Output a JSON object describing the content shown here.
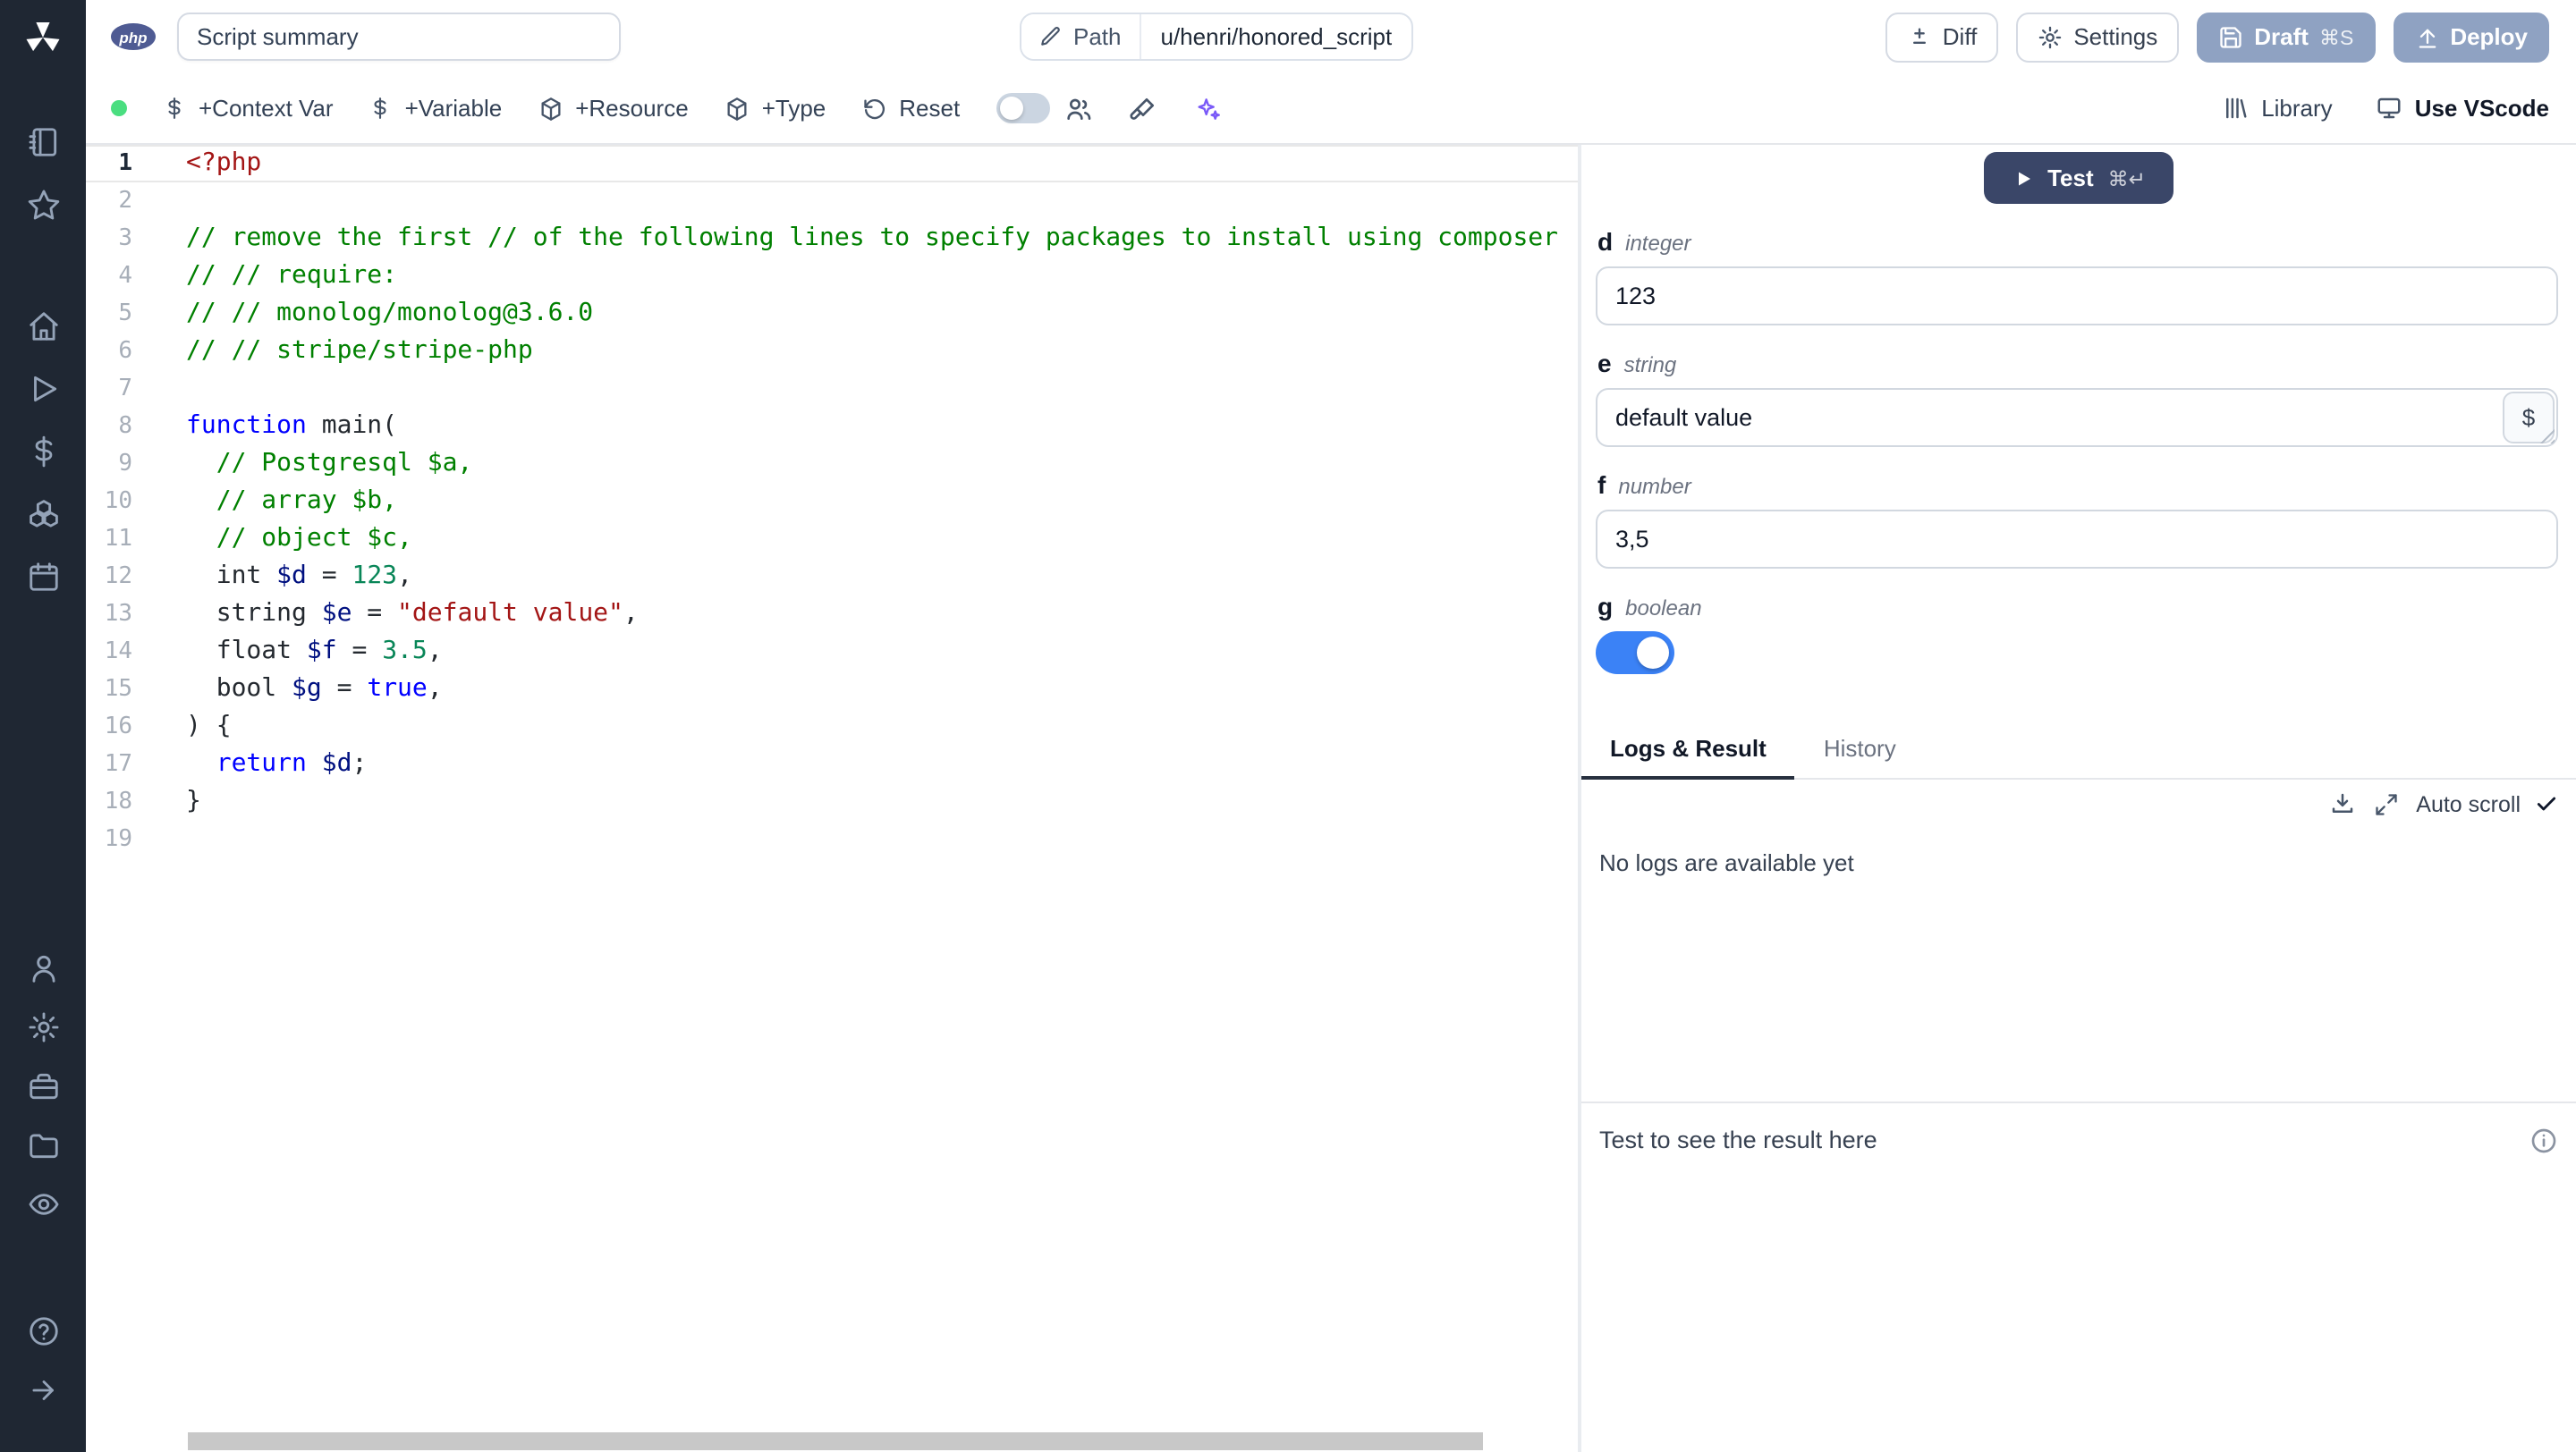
{
  "colors": {
    "sidebar_bg": "#1f2733",
    "accent_dark": "#3a4668",
    "accent_muted": "#8fa2c2",
    "toggle_on": "#3b82f6",
    "status_green": "#4ade80",
    "php_badge": "#4f5b93",
    "token_tag": "#a31515",
    "token_comment": "#008000",
    "token_keyword": "#0000ff",
    "token_variable": "#001080",
    "token_number": "#098658",
    "token_string": "#a31515",
    "token_plain": "#24292f"
  },
  "sidebar": {
    "groups": {
      "top": [
        "notebook",
        "star"
      ],
      "main": [
        "home",
        "play",
        "dollar",
        "boxes",
        "calendar"
      ],
      "account": [
        "user",
        "settings",
        "toolbox",
        "folder",
        "eye"
      ],
      "footer": [
        "help",
        "arrow-right"
      ]
    }
  },
  "topbar": {
    "language_badge": "php",
    "summary_value": "Script summary",
    "path_label": "Path",
    "path_value": "u/henri/honored_script",
    "diff_label": "Diff",
    "settings_label": "Settings",
    "draft_label": "Draft",
    "draft_shortcut": "⌘S",
    "deploy_label": "Deploy"
  },
  "toolbar": {
    "context_var_label": "+Context Var",
    "variable_label": "+Variable",
    "resource_label": "+Resource",
    "type_label": "+Type",
    "reset_label": "Reset",
    "library_label": "Library",
    "vscode_label": "Use VScode"
  },
  "editor": {
    "language": "php",
    "lines": [
      {
        "n": 1,
        "current": true,
        "tokens": [
          {
            "t": "<?php",
            "c": "tag"
          }
        ]
      },
      {
        "n": 2,
        "tokens": []
      },
      {
        "n": 3,
        "tokens": [
          {
            "t": "// remove the first // of the following lines to specify packages to install using composer",
            "c": "comment"
          }
        ]
      },
      {
        "n": 4,
        "tokens": [
          {
            "t": "// // require:",
            "c": "comment"
          }
        ]
      },
      {
        "n": 5,
        "tokens": [
          {
            "t": "// // monolog/monolog@3.6.0",
            "c": "comment"
          }
        ]
      },
      {
        "n": 6,
        "tokens": [
          {
            "t": "// // stripe/stripe-php",
            "c": "comment"
          }
        ]
      },
      {
        "n": 7,
        "tokens": []
      },
      {
        "n": 8,
        "tokens": [
          {
            "t": "function",
            "c": "keyword"
          },
          {
            "t": " main(",
            "c": "plain"
          }
        ]
      },
      {
        "n": 9,
        "tokens": [
          {
            "t": "  // Postgresql $a,",
            "c": "comment"
          }
        ]
      },
      {
        "n": 10,
        "tokens": [
          {
            "t": "  // array $b,",
            "c": "comment"
          }
        ]
      },
      {
        "n": 11,
        "tokens": [
          {
            "t": "  // object $c,",
            "c": "comment"
          }
        ]
      },
      {
        "n": 12,
        "tokens": [
          {
            "t": "  int ",
            "c": "plain"
          },
          {
            "t": "$d",
            "c": "variable"
          },
          {
            "t": " = ",
            "c": "plain"
          },
          {
            "t": "123",
            "c": "number"
          },
          {
            "t": ",",
            "c": "plain"
          }
        ]
      },
      {
        "n": 13,
        "tokens": [
          {
            "t": "  string ",
            "c": "plain"
          },
          {
            "t": "$e",
            "c": "variable"
          },
          {
            "t": " = ",
            "c": "plain"
          },
          {
            "t": "\"default value\"",
            "c": "string"
          },
          {
            "t": ",",
            "c": "plain"
          }
        ]
      },
      {
        "n": 14,
        "tokens": [
          {
            "t": "  float ",
            "c": "plain"
          },
          {
            "t": "$f",
            "c": "variable"
          },
          {
            "t": " = ",
            "c": "plain"
          },
          {
            "t": "3.5",
            "c": "number"
          },
          {
            "t": ",",
            "c": "plain"
          }
        ]
      },
      {
        "n": 15,
        "tokens": [
          {
            "t": "  bool ",
            "c": "plain"
          },
          {
            "t": "$g",
            "c": "variable"
          },
          {
            "t": " = ",
            "c": "plain"
          },
          {
            "t": "true",
            "c": "keyword"
          },
          {
            "t": ",",
            "c": "plain"
          }
        ]
      },
      {
        "n": 16,
        "tokens": [
          {
            "t": ") {",
            "c": "plain"
          }
        ]
      },
      {
        "n": 17,
        "tokens": [
          {
            "t": "  ",
            "c": "plain"
          },
          {
            "t": "return",
            "c": "keyword"
          },
          {
            "t": " ",
            "c": "plain"
          },
          {
            "t": "$d",
            "c": "variable"
          },
          {
            "t": ";",
            "c": "plain"
          }
        ]
      },
      {
        "n": 18,
        "tokens": [
          {
            "t": "}",
            "c": "plain"
          }
        ]
      },
      {
        "n": 19,
        "tokens": []
      }
    ]
  },
  "panel": {
    "test_label": "Test",
    "test_shortcut": "⌘↵",
    "fields": [
      {
        "name": "d",
        "type": "integer",
        "value": "123"
      },
      {
        "name": "e",
        "type": "string",
        "value": "default value",
        "has_var_btn": true
      },
      {
        "name": "f",
        "type": "number",
        "value": "3,5"
      },
      {
        "name": "g",
        "type": "boolean",
        "value": true
      }
    ],
    "tabs": [
      "Logs & Result",
      "History"
    ],
    "active_tab": "Logs & Result",
    "auto_scroll_label": "Auto scroll",
    "no_logs_text": "No logs are available yet",
    "result_placeholder": "Test to see the result here"
  }
}
